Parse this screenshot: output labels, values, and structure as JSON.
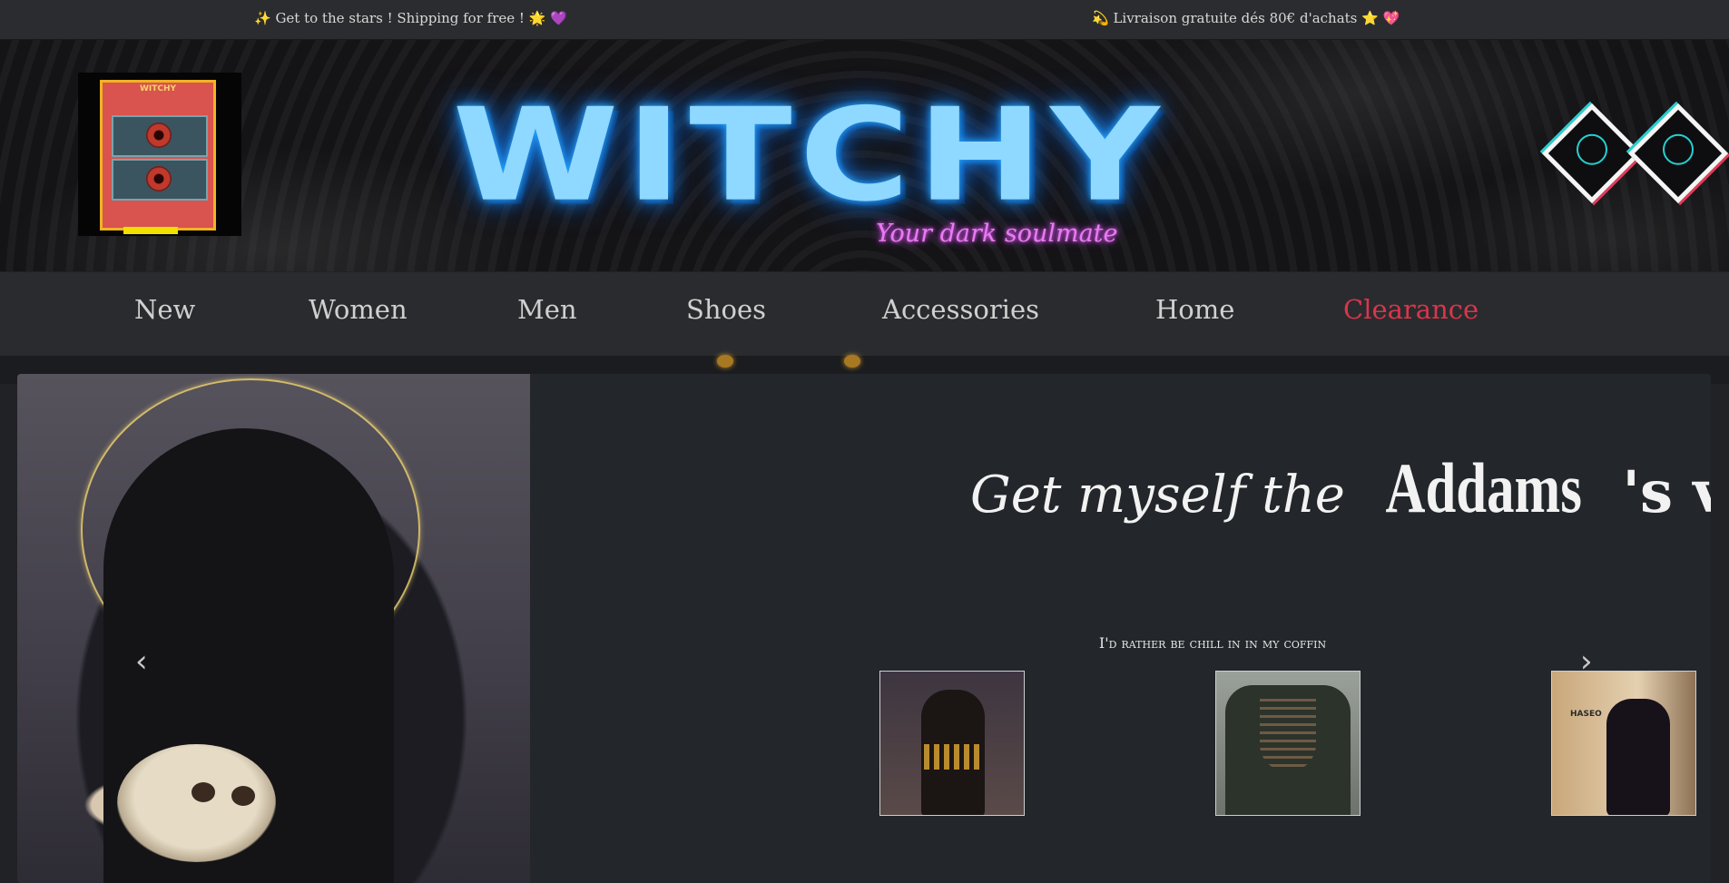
{
  "announcement": {
    "message_en": "✨ Get to the stars ! Shipping for free ! 🌟 💜",
    "message_fr": "💫 Livraison gratuite dés 80€ d'achats ⭐ 💖"
  },
  "banner": {
    "logo_card_title": "WITCHY",
    "wordmark": "WITCHY",
    "tagline": "Your dark soulmate"
  },
  "nav": {
    "items": [
      "New",
      "Women",
      "Men",
      "Shoes",
      "Accessories",
      "Home",
      "Clearance"
    ],
    "sale_color": "#d9364c"
  },
  "slider": {
    "headline_part1": "Get myself the",
    "headline_part2": "Addams",
    "headline_part3": "'s vibe",
    "subline": "I'd rather be chill in in my coffin",
    "thumb3_label": "HASEO",
    "prev_icon": "chevron-left-icon",
    "next_icon": "chevron-right-icon"
  },
  "colors": {
    "wordmark": "#8fd8ff",
    "tagline": "#e77cf2",
    "background": "#202225"
  }
}
